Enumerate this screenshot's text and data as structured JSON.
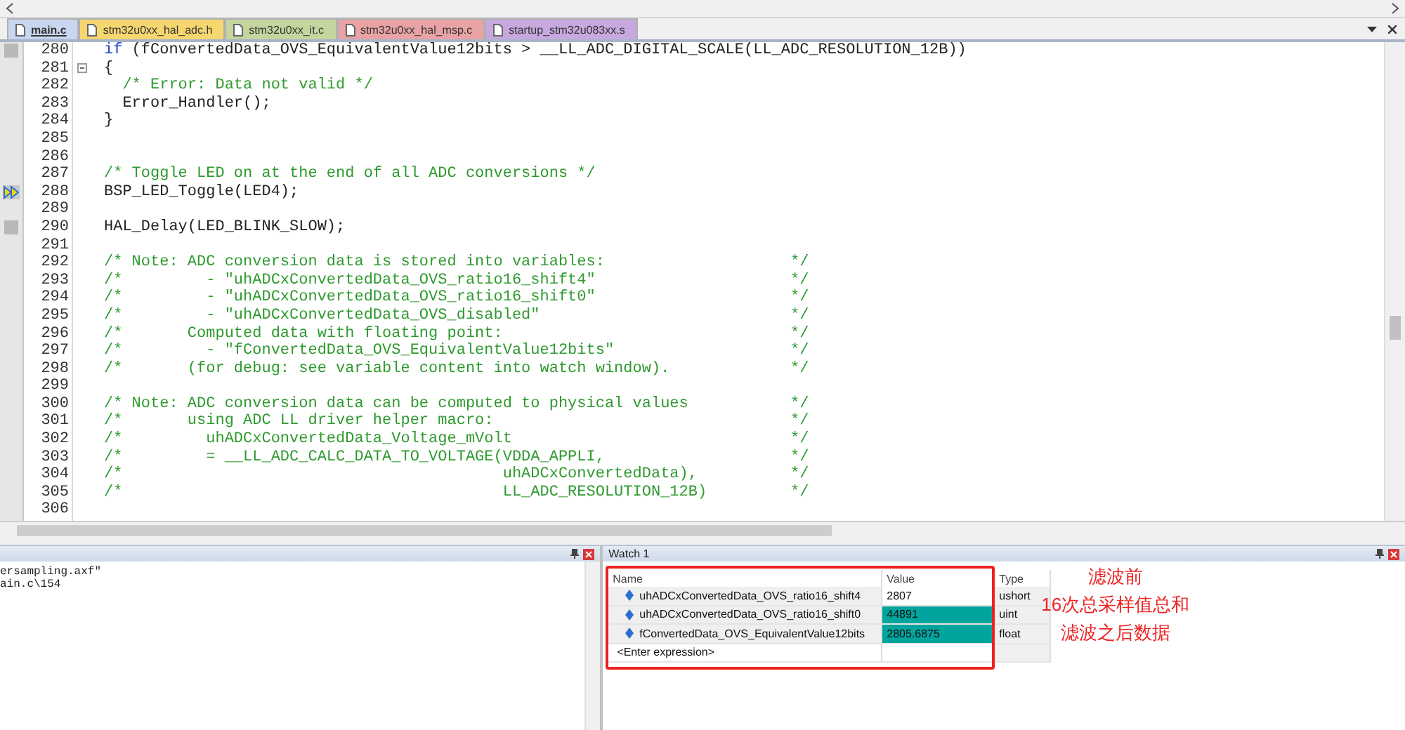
{
  "tabs": [
    {
      "label": "main.c",
      "selected": true,
      "color": "#c9d6f0"
    },
    {
      "label": "stm32u0xx_hal_adc.h",
      "selected": false,
      "color": "#f6d66f"
    },
    {
      "label": "stm32u0xx_it.c",
      "selected": false,
      "color": "#c4d69e"
    },
    {
      "label": "stm32u0xx_hal_msp.c",
      "selected": false,
      "color": "#e9a3a5"
    },
    {
      "label": "startup_stm32u083xx.s",
      "selected": false,
      "color": "#c7a8df"
    }
  ],
  "editor": {
    "lines": [
      {
        "n": "280",
        "kind": "code",
        "bookmark": true,
        "keyword": "if",
        "code": "(fConvertedData_OVS_EquivalentValue12bits > __LL_ADC_DIGITAL_SCALE(LL_ADC_RESOLUTION_12B))"
      },
      {
        "n": "281",
        "kind": "code",
        "fold": true,
        "code": "{"
      },
      {
        "n": "282",
        "kind": "comment",
        "code": "  /* Error: Data not valid */"
      },
      {
        "n": "283",
        "kind": "code",
        "code": "  Error_Handler();"
      },
      {
        "n": "284",
        "kind": "code",
        "code": "}"
      },
      {
        "n": "285",
        "kind": "blank"
      },
      {
        "n": "286",
        "kind": "blank"
      },
      {
        "n": "287",
        "kind": "comment",
        "code": "/* Toggle LED on at the end of all ADC conversions */"
      },
      {
        "n": "288",
        "kind": "code",
        "current": true,
        "code": "BSP_LED_Toggle(LED4);"
      },
      {
        "n": "289",
        "kind": "blank"
      },
      {
        "n": "290",
        "kind": "code",
        "bookmark": true,
        "code": "HAL_Delay(LED_BLINK_SLOW);"
      },
      {
        "n": "291",
        "kind": "blank"
      },
      {
        "n": "292",
        "kind": "comment",
        "code": "/* Note: ADC conversion data is stored into variables:",
        "tail": "*/"
      },
      {
        "n": "293",
        "kind": "comment",
        "code": "/*         - \"uhADCxConvertedData_OVS_ratio16_shift4\"",
        "tail": "*/"
      },
      {
        "n": "294",
        "kind": "comment",
        "code": "/*         - \"uhADCxConvertedData_OVS_ratio16_shift0\"",
        "tail": "*/"
      },
      {
        "n": "295",
        "kind": "comment",
        "code": "/*         - \"uhADCxConvertedData_OVS_disabled\"",
        "tail": "*/"
      },
      {
        "n": "296",
        "kind": "comment",
        "code": "/*       Computed data with floating point:",
        "tail": "*/"
      },
      {
        "n": "297",
        "kind": "comment",
        "code": "/*         - \"fConvertedData_OVS_EquivalentValue12bits\"",
        "tail": "*/"
      },
      {
        "n": "298",
        "kind": "comment",
        "code": "/*       (for debug: see variable content into watch window).",
        "tail": "*/"
      },
      {
        "n": "299",
        "kind": "blank"
      },
      {
        "n": "300",
        "kind": "comment",
        "code": "/* Note: ADC conversion data can be computed to physical values",
        "tail": "*/"
      },
      {
        "n": "301",
        "kind": "comment",
        "code": "/*       using ADC LL driver helper macro:",
        "tail": "*/"
      },
      {
        "n": "302",
        "kind": "comment",
        "code": "/*         uhADCxConvertedData_Voltage_mVolt",
        "tail": "*/"
      },
      {
        "n": "303",
        "kind": "comment",
        "code": "/*         = __LL_ADC_CALC_DATA_TO_VOLTAGE(VDDA_APPLI,",
        "tail": "*/"
      },
      {
        "n": "304",
        "kind": "comment",
        "code": "/*                                         uhADCxConvertedData),",
        "tail": "*/"
      },
      {
        "n": "305",
        "kind": "comment",
        "code": "/*                                         LL_ADC_RESOLUTION_12B)",
        "tail": "*/"
      },
      {
        "n": "306",
        "kind": "blank"
      }
    ]
  },
  "output": {
    "lines": [
      "ersampling.axf\"",
      "ain.c\\154"
    ]
  },
  "watch": {
    "title": "Watch 1",
    "columns": [
      "Name",
      "Value",
      "Type"
    ],
    "rows": [
      {
        "name": "uhADCxConvertedData_OVS_ratio16_shift4",
        "value": "2807",
        "type": "ushort",
        "changed": false
      },
      {
        "name": "uhADCxConvertedData_OVS_ratio16_shift0",
        "value": "44891",
        "type": "uint",
        "changed": true
      },
      {
        "name": "fConvertedData_OVS_EquivalentValue12bits",
        "value": "2805.6875",
        "type": "float",
        "changed": true
      }
    ],
    "placeholder": "<Enter expression>",
    "annotations": [
      "滤波前",
      "16次总采样值总和",
      "滤波之后数据"
    ]
  }
}
